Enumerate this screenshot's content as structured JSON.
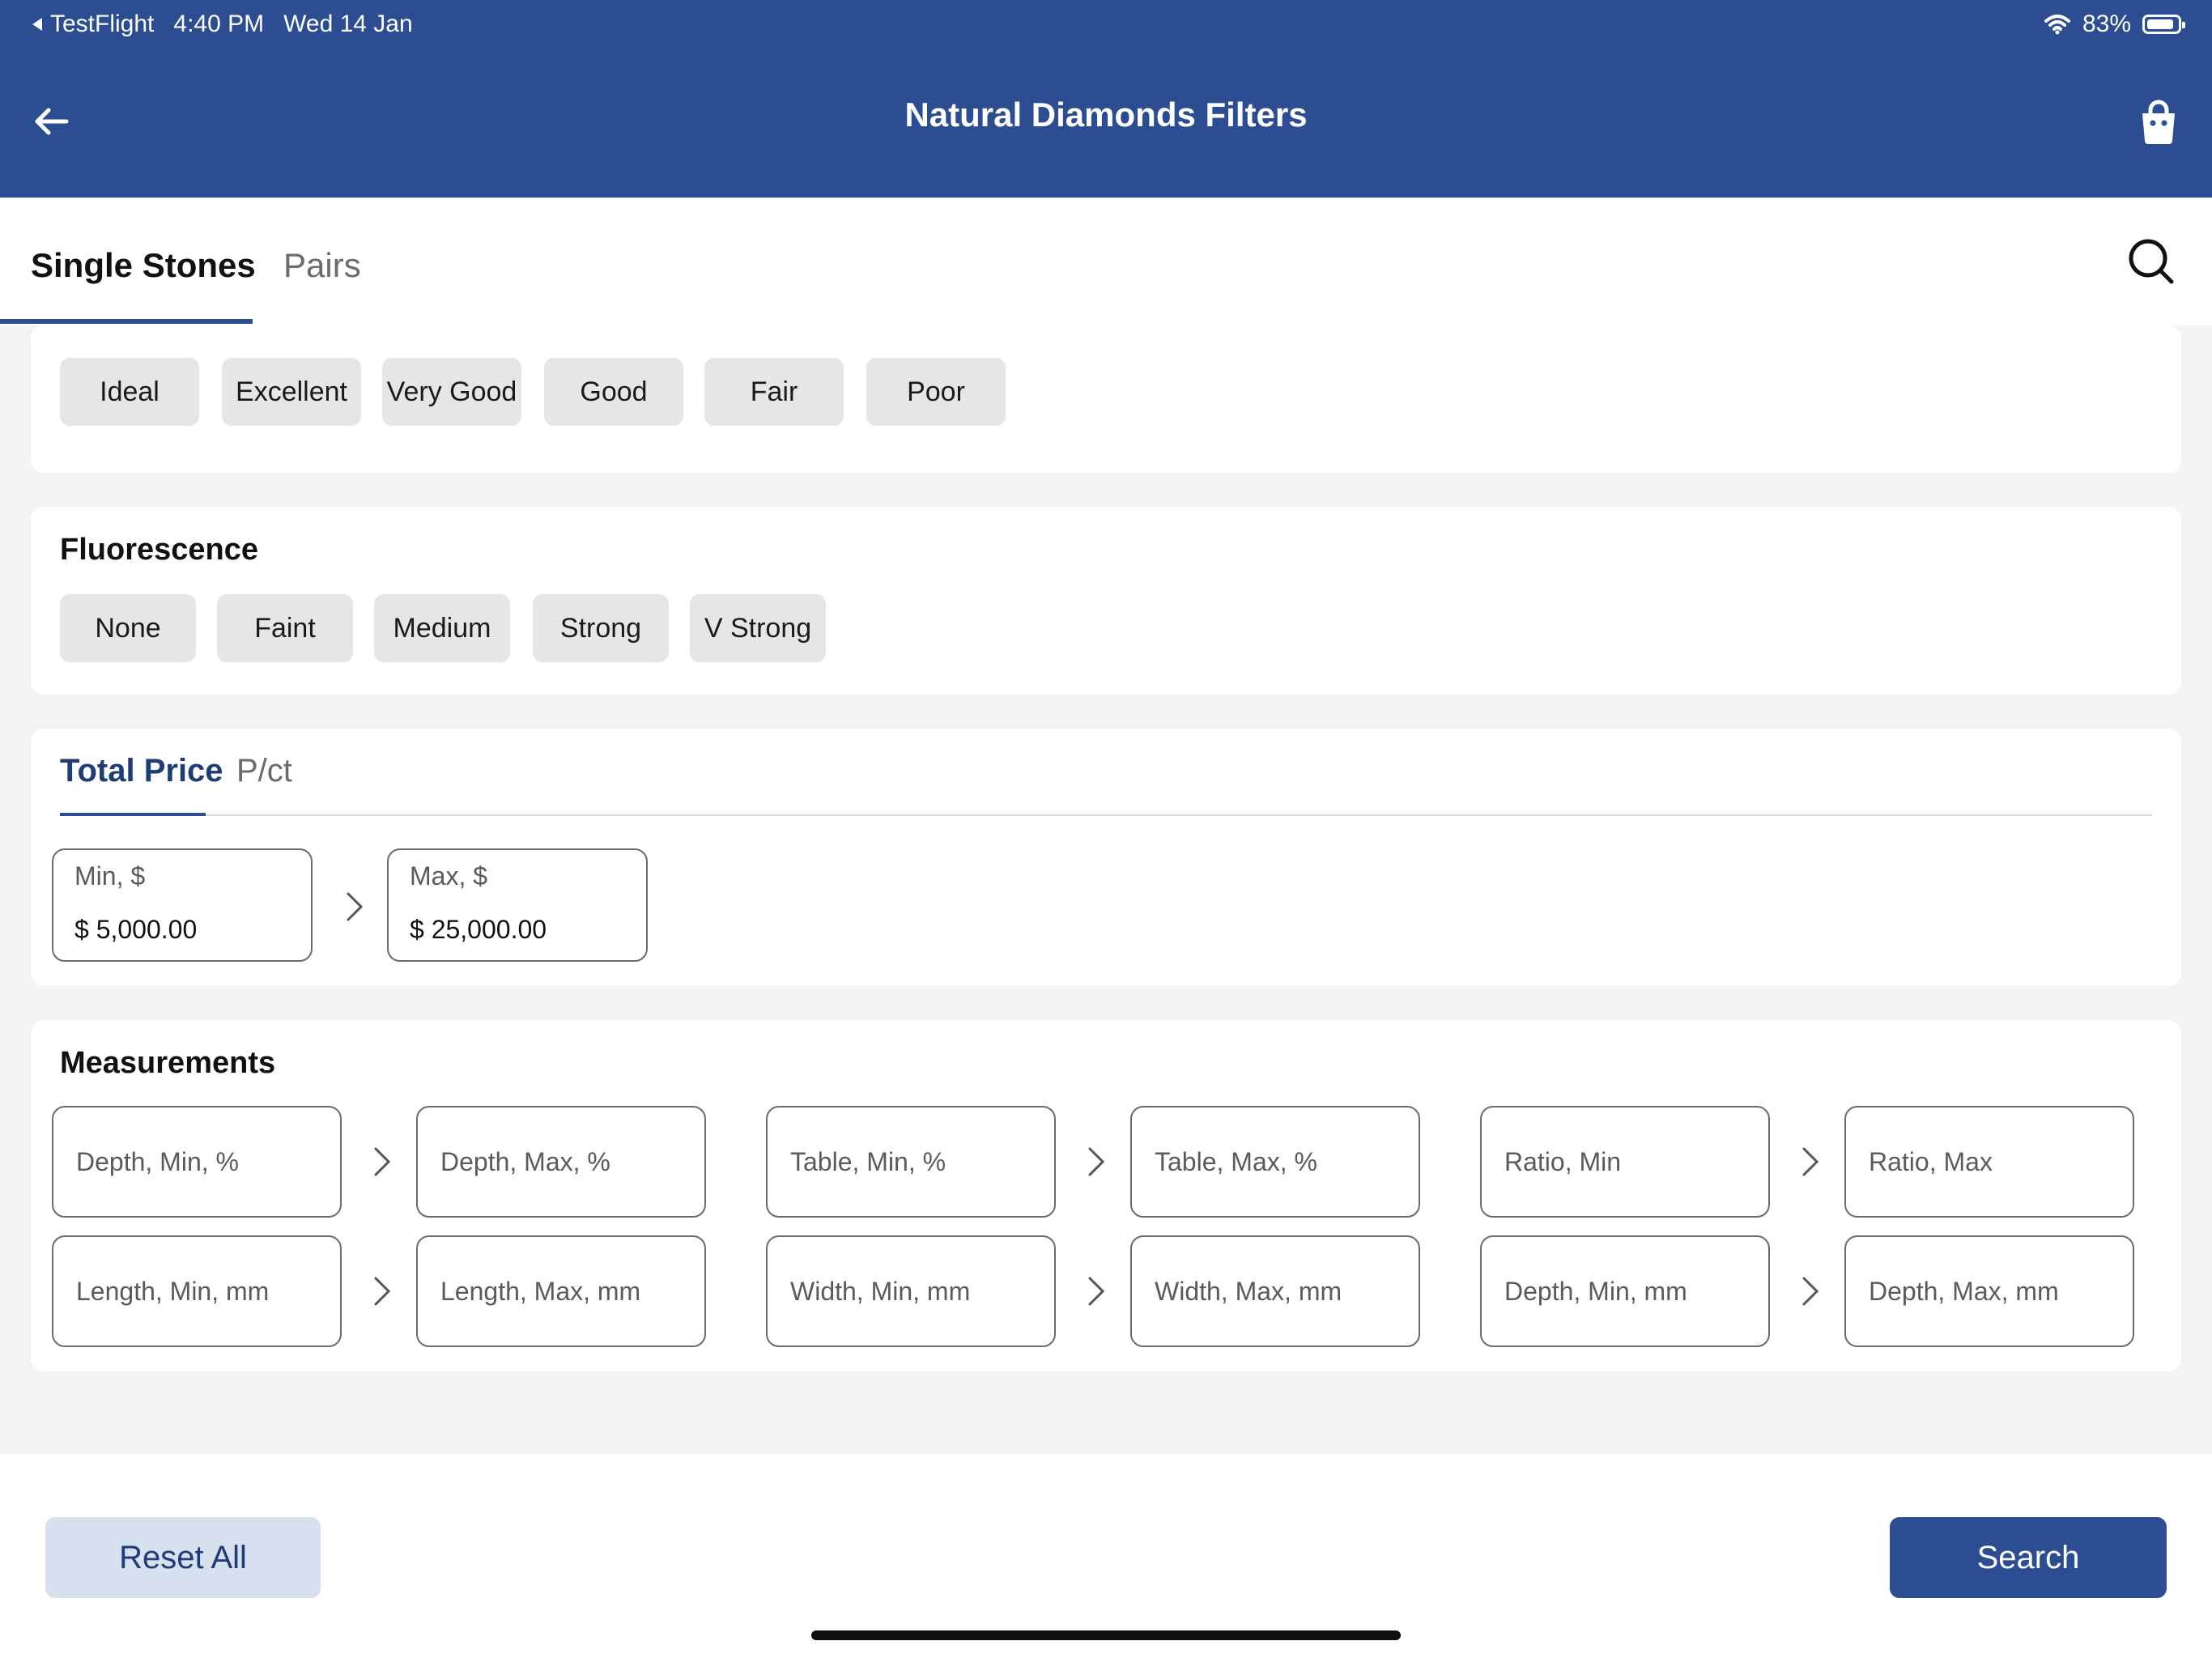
{
  "status_bar": {
    "app": "TestFlight",
    "time": "4:40 PM",
    "date": "Wed 14 Jan",
    "battery": "83%",
    "battery_level": 0.83
  },
  "header": {
    "title": "Natural Diamonds Filters",
    "back_icon": "arrow-left-icon",
    "cart_icon": "shopping-bag-icon"
  },
  "tabs": {
    "items": [
      "Single Stones",
      "Pairs"
    ],
    "active": "Single Stones",
    "search_icon": "search-icon"
  },
  "cut": {
    "options": [
      "Ideal",
      "Excellent",
      "Very Good",
      "Good",
      "Fair",
      "Poor"
    ]
  },
  "fluorescence": {
    "title": "Fluorescence",
    "options": [
      "None",
      "Faint",
      "Medium",
      "Strong",
      "V Strong"
    ]
  },
  "price": {
    "tabs": [
      "Total Price",
      "P/ct"
    ],
    "active_tab": "Total Price",
    "min_label": "Min, $",
    "min_value": "$ 5,000.00",
    "max_label": "Max, $",
    "max_value": "$ 25,000.00"
  },
  "measurements": {
    "title": "Measurements",
    "fields": [
      "Depth, Min, %",
      "Depth, Max, %",
      "Table, Min, %",
      "Table, Max, %",
      "Ratio, Min",
      "Ratio, Max",
      "Length, Min, mm",
      "Length, Max, mm",
      "Width, Min, mm",
      "Width, Max, mm",
      "Depth, Min, mm",
      "Depth, Max, mm"
    ]
  },
  "footer": {
    "reset_label": "Reset All",
    "search_label": "Search"
  },
  "colors": {
    "brand": "#2c4d91",
    "chip_bg": "#e6e6e6",
    "reset_bg": "#d6e0ee"
  }
}
